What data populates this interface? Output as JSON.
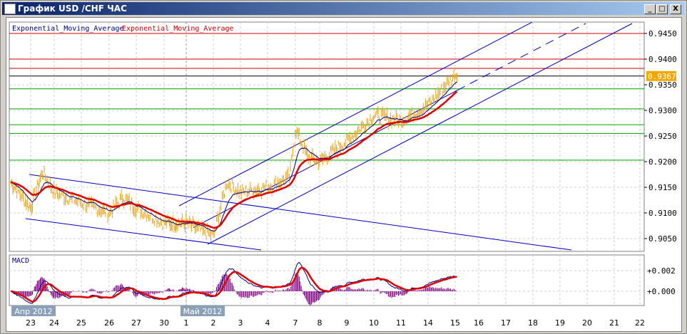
{
  "window": {
    "title": "График USD /CHF ЧАС",
    "minimize": "_",
    "maximize": "□",
    "close": "X"
  },
  "indicators": {
    "ema1": "Exponential_Moving_Average",
    "ema2": "Exponential_Moving_Average",
    "macd": "MACD"
  },
  "colors": {
    "price": "#e8a317",
    "ema_fast": "#000080",
    "ema_slow": "#e00000",
    "hist": "#800080",
    "channel": "#0000c0",
    "red_level": "#cc0000",
    "green_level": "#00a000"
  },
  "price_axis": [
    "0.9450",
    "0.9400",
    "0.9350",
    "0.9300",
    "0.9250",
    "0.9200",
    "0.9150",
    "0.9100",
    "0.9050"
  ],
  "current_price": "0.9367",
  "macd_axis": [
    "+0.002",
    "+0.000"
  ],
  "month_labels": [
    "Апр 2012",
    "Май 2012"
  ],
  "date_labels": [
    "23",
    "24",
    "25",
    "26",
    "27",
    "30",
    "1",
    "2",
    "3",
    "4",
    "7",
    "8",
    "9",
    "10",
    "11",
    "14",
    "15",
    "16",
    "17",
    "18",
    "19",
    "20",
    "21",
    "22"
  ],
  "chart_data": {
    "type": "line",
    "symbol": "USD/CHF",
    "timeframe": "H1",
    "levels": {
      "red": [
        0.945,
        0.94,
        0.9382
      ],
      "black": [
        0.9367
      ],
      "green": [
        0.9342,
        0.9303,
        0.9272,
        0.9255,
        0.9203
      ]
    },
    "price_keypoints": [
      [
        -0.8,
        0.916
      ],
      [
        0,
        0.911
      ],
      [
        0.5,
        0.918
      ],
      [
        1,
        0.914
      ],
      [
        2,
        0.912
      ],
      [
        3,
        0.91
      ],
      [
        3.5,
        0.913
      ],
      [
        4,
        0.911
      ],
      [
        5,
        0.908
      ],
      [
        6,
        0.908
      ],
      [
        7,
        0.9055
      ],
      [
        7.5,
        0.916
      ],
      [
        8,
        0.914
      ],
      [
        9,
        0.915
      ],
      [
        9.8,
        0.917
      ],
      [
        10,
        0.9265
      ],
      [
        10.5,
        0.921
      ],
      [
        11,
        0.92
      ],
      [
        12,
        0.924
      ],
      [
        13,
        0.929
      ],
      [
        14,
        0.928
      ],
      [
        15,
        0.931
      ],
      [
        16,
        0.937
      ],
      [
        16.1,
        0.9367
      ]
    ]
  }
}
